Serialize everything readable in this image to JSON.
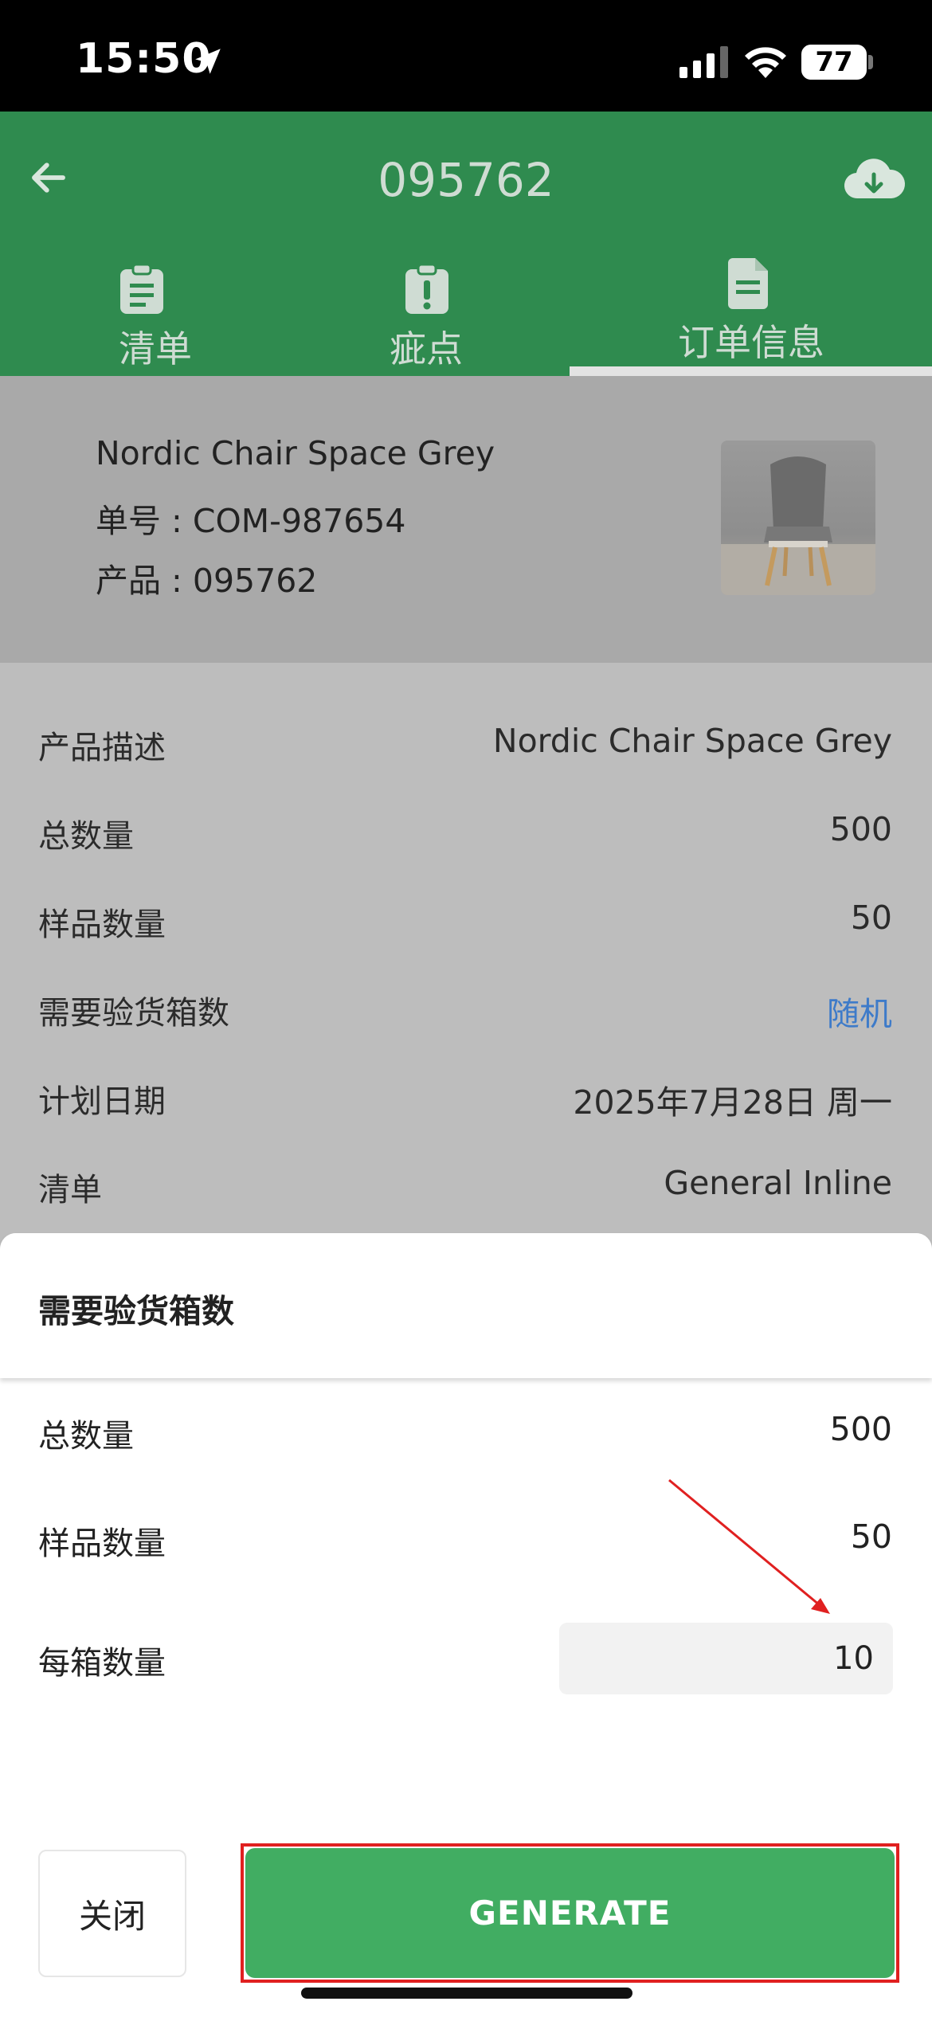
{
  "status_bar": {
    "time": "15:50",
    "battery": "77"
  },
  "header": {
    "title": "095762",
    "back_icon": "arrow-left-icon",
    "download_icon": "cloud-download-icon"
  },
  "tabs": [
    {
      "label": "清单",
      "icon": "clipboard-icon"
    },
    {
      "label": "疵点",
      "icon": "alert-clipboard-icon"
    },
    {
      "label": "订单信息",
      "icon": "document-icon",
      "active": true
    }
  ],
  "summary": {
    "name": "Nordic Chair Space Grey",
    "order": "单号 : COM-987654",
    "product": "产品 : 095762"
  },
  "details": [
    {
      "label": "产品描述",
      "value": "Nordic Chair Space Grey"
    },
    {
      "label": "总数量",
      "value": "500"
    },
    {
      "label": "样品数量",
      "value": "50"
    },
    {
      "label": "需要验货箱数",
      "value": "随机"
    },
    {
      "label": "计划日期",
      "value": "2025年7月28日 周一"
    },
    {
      "label": "清单",
      "value": "General Inline"
    }
  ],
  "sheet": {
    "title": "需要验货箱数",
    "total_label": "总数量",
    "total_value": "500",
    "sample_label": "样品数量",
    "sample_value": "50",
    "per_box_label": "每箱数量",
    "per_box_value": "10",
    "close_label": "关闭",
    "generate_label": "GENERATE"
  },
  "colors": {
    "header_green": "#2f8b4f",
    "button_green": "#41ad62",
    "link_blue": "#3e7bc9",
    "annotation_red": "#e02020"
  }
}
